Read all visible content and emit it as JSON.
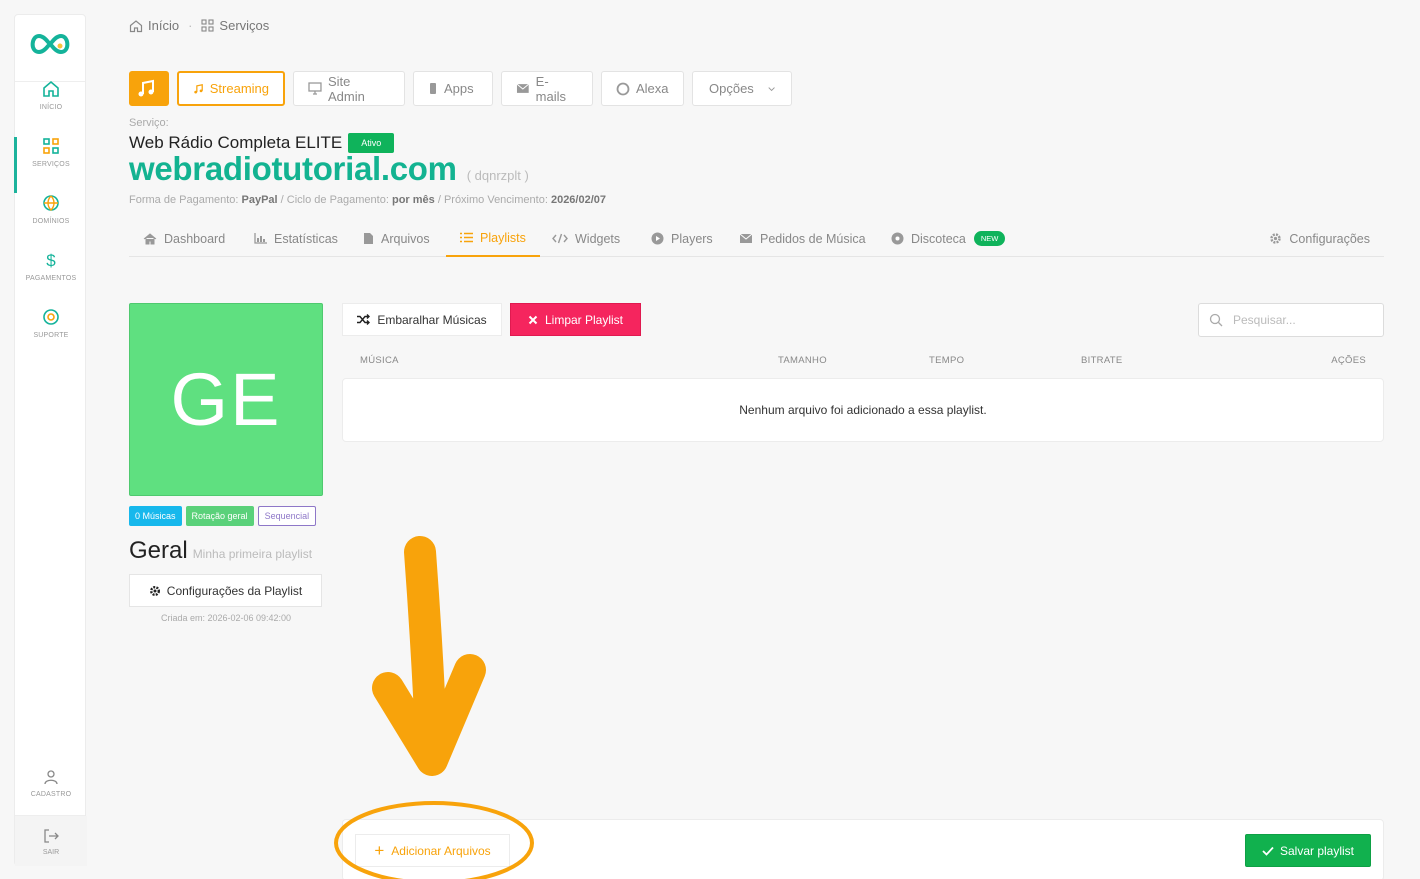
{
  "sidebar": {
    "items": [
      {
        "label": "INÍCIO",
        "icon": "home-icon"
      },
      {
        "label": "SERVIÇOS",
        "icon": "grid-icon"
      },
      {
        "label": "DOMÍNIOS",
        "icon": "globe-icon"
      },
      {
        "label": "PAGAMENTOS",
        "icon": "dollar-icon"
      },
      {
        "label": "SUPORTE",
        "icon": "lifebuoy-icon"
      }
    ],
    "account_label": "CADASTRO",
    "exit_label": "SAIR",
    "accent_color": "#1db39c"
  },
  "breadcrumb": {
    "home": "Início",
    "current": "Serviços",
    "separator": "·"
  },
  "topbar": {
    "streaming": "Streaming",
    "site_admin": "Site Admin",
    "apps": "Apps",
    "emails": "E-mails",
    "alexa": "Alexa",
    "options": "Opções",
    "accent_color": "#f8a30b"
  },
  "service": {
    "label": "Serviço:",
    "plan": "Web Rádio Completa ELITE",
    "status": "Ativo",
    "domain": "webradiotutorial.com",
    "code": "( dqnrzplt )",
    "payment_label": "Forma de Pagamento:",
    "payment_value": "PayPal",
    "cycle_label": "/ Ciclo de Pagamento:",
    "cycle_value": "por mês",
    "due_label": "/ Próximo Vencimento:",
    "due_value": "2026/02/07"
  },
  "tabs": {
    "dashboard": "Dashboard",
    "stats": "Estatísticas",
    "files": "Arquivos",
    "playlists": "Playlists",
    "widgets": "Widgets",
    "players": "Players",
    "requests": "Pedidos de Música",
    "discoteca": "Discoteca",
    "new_badge": "NEW",
    "config": "Configurações",
    "active": "Playlists"
  },
  "playlist": {
    "initials": "GE",
    "cover_color": "#5fe080",
    "count_badge": "0 Músicas",
    "rotation_badge": "Rotação geral",
    "order_badge": "Sequencial",
    "name": "Geral",
    "description": "Minha primeira playlist",
    "config_button": "Configurações da Playlist",
    "created": "Criada em: 2026-02-06 09:42:00"
  },
  "actions": {
    "shuffle": "Embaralhar Músicas",
    "clear": "Limpar Playlist",
    "search_placeholder": "Pesquisar..."
  },
  "table": {
    "columns": [
      "MÚSICA",
      "TAMANHO",
      "TEMPO",
      "BITRATE",
      "AÇÕES"
    ],
    "empty_message": "Nenhum arquivo foi adicionado a essa playlist."
  },
  "footer": {
    "add_files": "Adicionar Arquivos",
    "save": "Salvar playlist"
  },
  "annotation": {
    "color": "#f8a30b"
  }
}
